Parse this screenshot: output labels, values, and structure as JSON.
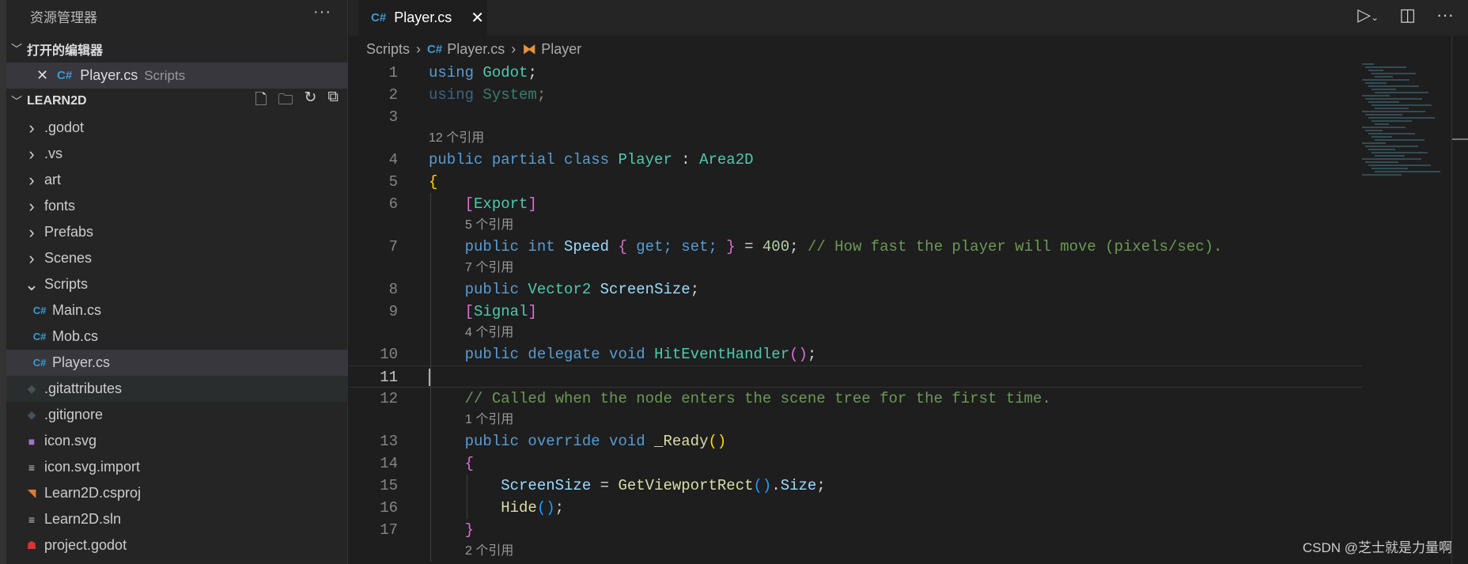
{
  "sidebar": {
    "title": "资源管理器",
    "more": "···",
    "open_editors": {
      "label": "打开的编辑器",
      "item": {
        "name": "Player.cs",
        "dir": "Scripts"
      }
    },
    "project": {
      "label": "LEARN2D"
    },
    "tree": [
      {
        "label": ".godot",
        "icon": "chevron-right",
        "indent": 0
      },
      {
        "label": ".vs",
        "icon": "chevron-right",
        "indent": 0
      },
      {
        "label": "art",
        "icon": "chevron-right",
        "indent": 0
      },
      {
        "label": "fonts",
        "icon": "chevron-right",
        "indent": 0
      },
      {
        "label": "Prefabs",
        "icon": "chevron-right",
        "indent": 0
      },
      {
        "label": "Scenes",
        "icon": "chevron-right",
        "indent": 0
      },
      {
        "label": "Scripts",
        "icon": "chevron-down",
        "indent": 0
      },
      {
        "label": "Main.cs",
        "icon": "csharp",
        "indent": 1
      },
      {
        "label": "Mob.cs",
        "icon": "csharp",
        "indent": 1
      },
      {
        "label": "Player.cs",
        "icon": "csharp",
        "indent": 1,
        "selected": true
      },
      {
        "label": ".gitattributes",
        "icon": "git",
        "indent": 0,
        "hover": true
      },
      {
        "label": ".gitignore",
        "icon": "git",
        "indent": 0
      },
      {
        "label": "icon.svg",
        "icon": "svg",
        "indent": 0
      },
      {
        "label": "icon.svg.import",
        "icon": "lines",
        "indent": 0
      },
      {
        "label": "Learn2D.csproj",
        "icon": "rss",
        "indent": 0
      },
      {
        "label": "Learn2D.sln",
        "icon": "lines",
        "indent": 0
      },
      {
        "label": "project.godot",
        "icon": "godot",
        "indent": 0
      }
    ]
  },
  "tab": {
    "label": "Player.cs"
  },
  "breadcrumb": {
    "folder": "Scripts",
    "file": "Player.cs",
    "symbol": "Player"
  },
  "code": [
    {
      "n": "1",
      "t": [
        [
          "using",
          "kw"
        ],
        [
          " ",
          "pl"
        ],
        [
          "Godot",
          "ty"
        ],
        [
          ";",
          "pl"
        ]
      ]
    },
    {
      "n": "2",
      "dim": true,
      "t": [
        [
          "using",
          "kw"
        ],
        [
          " ",
          "pl"
        ],
        [
          "System",
          "ty"
        ],
        [
          ";",
          "pl"
        ]
      ]
    },
    {
      "n": "3",
      "t": []
    },
    {
      "lens": "12 个引用"
    },
    {
      "n": "4",
      "t": [
        [
          "public partial class ",
          "kw"
        ],
        [
          "Player",
          "ty"
        ],
        [
          " : ",
          "pl"
        ],
        [
          "Area2D",
          "ty"
        ]
      ]
    },
    {
      "n": "5",
      "t": [
        [
          "{",
          "b1"
        ]
      ]
    },
    {
      "n": "6",
      "g": 1,
      "t": [
        [
          "    ",
          "pl"
        ],
        [
          "[",
          "b2"
        ],
        [
          "Export",
          "ty"
        ],
        [
          "]",
          "b2"
        ]
      ]
    },
    {
      "lens": "5 个引用",
      "g": 1
    },
    {
      "n": "7",
      "g": 1,
      "t": [
        [
          "    ",
          "pl"
        ],
        [
          "public int ",
          "kw"
        ],
        [
          "Speed ",
          "va"
        ],
        [
          "{",
          "b2"
        ],
        [
          " get; set; ",
          "kw"
        ],
        [
          "}",
          "b2"
        ],
        [
          " = ",
          "pl"
        ],
        [
          "400",
          "nu"
        ],
        [
          "; ",
          "pl"
        ],
        [
          "// How fast the player will move (pixels/sec).",
          "cm"
        ]
      ]
    },
    {
      "lens": "7 个引用",
      "g": 1
    },
    {
      "n": "8",
      "g": 1,
      "t": [
        [
          "    ",
          "pl"
        ],
        [
          "public ",
          "kw"
        ],
        [
          "Vector2 ",
          "ty"
        ],
        [
          "ScreenSize",
          "va"
        ],
        [
          ";",
          "pl"
        ]
      ]
    },
    {
      "n": "9",
      "g": 1,
      "t": [
        [
          "    ",
          "pl"
        ],
        [
          "[",
          "b2"
        ],
        [
          "Signal",
          "ty"
        ],
        [
          "]",
          "b2"
        ]
      ]
    },
    {
      "lens": "4 个引用",
      "g": 1
    },
    {
      "n": "10",
      "g": 1,
      "t": [
        [
          "    ",
          "pl"
        ],
        [
          "public delegate void ",
          "kw"
        ],
        [
          "HitEventHandler",
          "ty"
        ],
        [
          "(",
          "b2"
        ],
        [
          ")",
          "b2"
        ],
        [
          ";",
          "pl"
        ]
      ]
    },
    {
      "n": "11",
      "g": 1,
      "cur": true,
      "t": []
    },
    {
      "n": "12",
      "g": 1,
      "t": [
        [
          "    ",
          "pl"
        ],
        [
          "// Called when the node enters the scene tree for the first time.",
          "cm"
        ]
      ]
    },
    {
      "lens": "1 个引用",
      "g": 1
    },
    {
      "n": "13",
      "g": 1,
      "t": [
        [
          "    ",
          "pl"
        ],
        [
          "public override void ",
          "kw"
        ],
        [
          "_Ready",
          "fn"
        ],
        [
          "()",
          "b1"
        ]
      ]
    },
    {
      "n": "14",
      "g": 1,
      "t": [
        [
          "    ",
          "pl"
        ],
        [
          "{",
          "b2"
        ]
      ]
    },
    {
      "n": "15",
      "g": 2,
      "t": [
        [
          "        ",
          "pl"
        ],
        [
          "ScreenSize",
          "va"
        ],
        [
          " = ",
          "pl"
        ],
        [
          "GetViewportRect",
          "fn"
        ],
        [
          "()",
          "b3"
        ],
        [
          ".",
          "pl"
        ],
        [
          "Size",
          "va"
        ],
        [
          ";",
          "pl"
        ]
      ]
    },
    {
      "n": "16",
      "g": 2,
      "t": [
        [
          "        ",
          "pl"
        ],
        [
          "Hide",
          "fn"
        ],
        [
          "()",
          "b3"
        ],
        [
          ";",
          "pl"
        ]
      ]
    },
    {
      "n": "17",
      "g": 1,
      "t": [
        [
          "    ",
          "pl"
        ],
        [
          "}",
          "b2"
        ]
      ]
    },
    {
      "lens": "2 个引用",
      "g": 1
    }
  ],
  "watermark": "CSDN @芝士就是力量啊"
}
